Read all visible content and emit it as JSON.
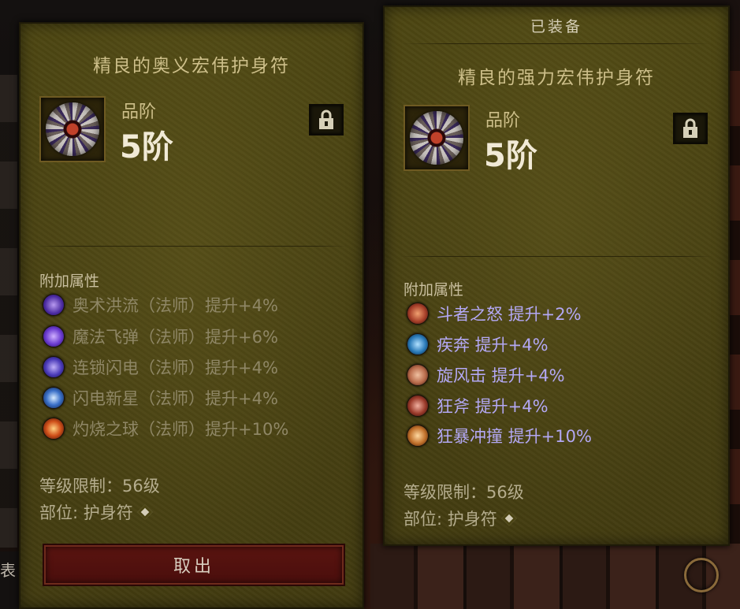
{
  "left_panel": {
    "title": "精良的奥义宏伟护身符",
    "rank_label": "品阶",
    "rank_value": "5阶",
    "attributes_label": "附加属性",
    "attributes": [
      {
        "text": "奥术洪流（法师）提升+4%",
        "icon": "arcane-torrent-icon",
        "color": "#6a3ad0"
      },
      {
        "text": "魔法飞弹（法师）提升+6%",
        "icon": "magic-missile-icon",
        "color": "#7a4ae0"
      },
      {
        "text": "连锁闪电（法师）提升+4%",
        "icon": "chain-lightning-icon",
        "color": "#5a3ab8"
      },
      {
        "text": "闪电新星（法师）提升+4%",
        "icon": "lightning-nova-icon",
        "color": "#2a5aa8"
      },
      {
        "text": "灼烧之球（法师）提升+10%",
        "icon": "burning-orb-icon",
        "color": "#c8501a"
      }
    ],
    "level_req": "等级限制：56级",
    "slot": "部位: 护身符",
    "take_out_label": "取出"
  },
  "right_panel": {
    "equipped_label": "已装备",
    "title": "精良的强力宏伟护身符",
    "rank_label": "品阶",
    "rank_value": "5阶",
    "attributes_label": "附加属性",
    "attributes": [
      {
        "text": "斗者之怒  提升+2%",
        "icon": "fighters-rage-icon",
        "color": "#a8402a"
      },
      {
        "text": "疾奔  提升+4%",
        "icon": "sprint-icon",
        "color": "#2a7ab8"
      },
      {
        "text": "旋风击  提升+4%",
        "icon": "whirlwind-icon",
        "color": "#b86a4a"
      },
      {
        "text": "狂斧  提升+4%",
        "icon": "frenzy-axe-icon",
        "color": "#9a3a2a"
      },
      {
        "text": "狂暴冲撞  提升+10%",
        "icon": "berserk-charge-icon",
        "color": "#c0702a"
      }
    ],
    "level_req": "等级限制：56级",
    "slot": "部位: 护身符"
  },
  "background": {
    "left_edge_char": "表"
  }
}
